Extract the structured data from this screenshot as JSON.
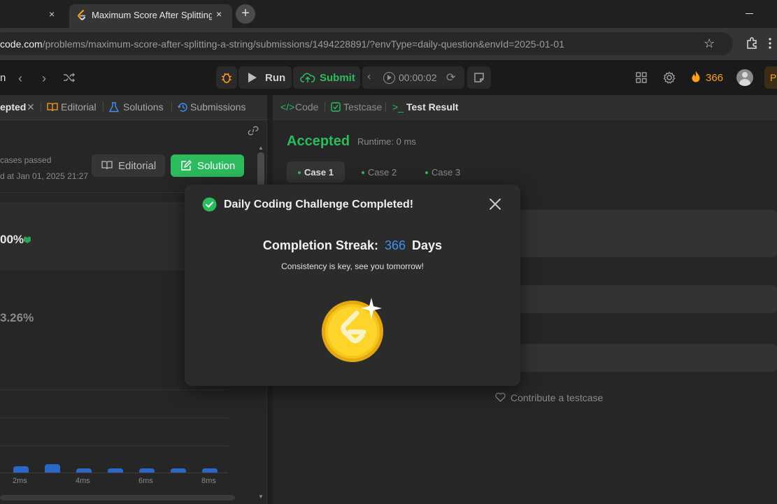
{
  "browser": {
    "prev_tab_close": "×",
    "active_tab_title": "Maximum Score After Splitting a String",
    "active_tab_close": "×",
    "new_tab": "+",
    "url_domain": "code.com",
    "url_path": "/problems/maximum-score-after-splitting-a-string/submissions/1494228891/?envType=daily-question&envId=2025-01-01"
  },
  "toolbar": {
    "left_text": "n",
    "run_label": "Run",
    "submit_label": "Submit",
    "timer": "00:00:02",
    "streak_count": "366"
  },
  "left_panel": {
    "tabs": {
      "accepted": "epted",
      "editorial": "Editorial",
      "solutions": "Solutions",
      "submissions": "Submissions"
    },
    "cases_passed": "cases passed",
    "submitted_at": "d at Jan 01, 2025 21:27",
    "editorial_button": "Editorial",
    "solution_button": "Solution",
    "runtime_beats": "00%",
    "memory_beats": "3.26%",
    "chart_ticks": [
      "2ms",
      "4ms",
      "6ms",
      "8ms"
    ]
  },
  "right_panel": {
    "tabs": {
      "code": "Code",
      "testcase": "Testcase",
      "test_result": "Test Result"
    },
    "status": "Accepted",
    "runtime": "Runtime: 0 ms",
    "cases": [
      "Case 1",
      "Case 2",
      "Case 3"
    ],
    "contribute": "Contribute a testcase"
  },
  "modal": {
    "title": "Daily Coding Challenge Completed!",
    "streak_prefix": "Completion Streak:",
    "streak_value": "366",
    "streak_suffix": "Days",
    "tagline": "Consistency is key, see you tomorrow!"
  },
  "colors": {
    "accent_green": "#2cbb5d",
    "streak_orange": "#ffa116",
    "streak_blue": "#3f8ef1",
    "coin_gold": "#f5c518"
  }
}
